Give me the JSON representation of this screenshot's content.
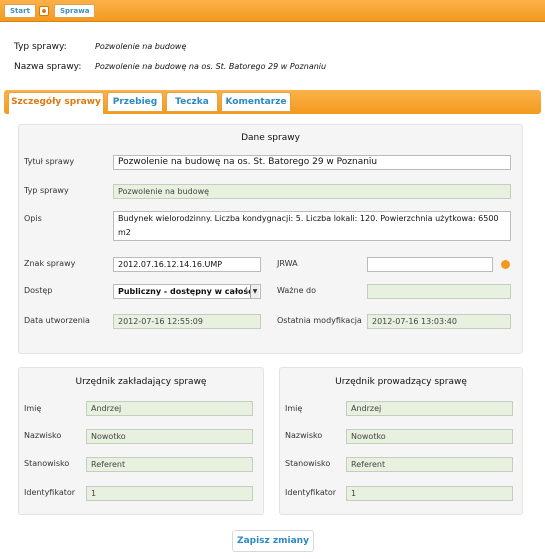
{
  "breadcrumb": {
    "start": "Start",
    "sprawa": "Sprawa"
  },
  "header": {
    "typ_label": "Typ sprawy:",
    "typ_value": "Pozwolenie na budowę",
    "nazwa_label": "Nazwa sprawy:",
    "nazwa_value": "Pozwolenie na budowę na os. St. Batorego 29 w Poznaniu"
  },
  "tabs": [
    {
      "label": "Szczegóły sprawy",
      "active": true
    },
    {
      "label": "Przebieg",
      "active": false
    },
    {
      "label": "Teczka",
      "active": false
    },
    {
      "label": "Komentarze",
      "active": false
    }
  ],
  "dane": {
    "title": "Dane sprawy",
    "tytul_label": "Tytuł sprawy",
    "tytul_value": "Pozwolenie na budowę na os. St. Batorego 29 w Poznaniu",
    "typ_label": "Typ sprawy",
    "typ_value": "Pozwolenie na budowę",
    "opis_label": "Opis",
    "opis_value": "Budynek wielorodzinny. Liczba kondygnacji: 5. Liczba lokali: 120. Powierzchnia użytkowa: 6500 m2",
    "znak_label": "Znak sprawy",
    "znak_value": "2012.07.16.12.14.16.UMP",
    "jrwa_label": "JRWA",
    "jrwa_value": "",
    "dostep_label": "Dostęp",
    "dostep_value": "Publiczny - dostępny w całości",
    "wazne_label": "Ważne do",
    "wazne_value": "",
    "data_label": "Data utworzenia",
    "data_value": "2012-07-16 12:55:09",
    "mod_label": "Ostatnia modyfikacja",
    "mod_value": "2012-07-16 13:03:40"
  },
  "zakladajacy": {
    "title": "Urzędnik zakładający sprawę",
    "imie_label": "Imię",
    "imie": "Andrzej",
    "nazwisko_label": "Nazwisko",
    "nazwisko": "Nowotko",
    "stanowisko_label": "Stanowisko",
    "stanowisko": "Referent",
    "id_label": "Identyfikator",
    "id": "1"
  },
  "prowadzacy": {
    "title": "Urzędnik prowadzący sprawę",
    "imie_label": "Imię",
    "imie": "Andrzej",
    "nazwisko_label": "Nazwisko",
    "nazwisko": "Nowotko",
    "stanowisko_label": "Stanowisko",
    "stanowisko": "Referent",
    "id_label": "Identyfikator",
    "id": "1"
  },
  "save_label": "Zapisz zmiany",
  "colors": {
    "accent": "#f39a1e",
    "link": "#2c8ac2",
    "readonly_bg": "#e8f0e0"
  }
}
